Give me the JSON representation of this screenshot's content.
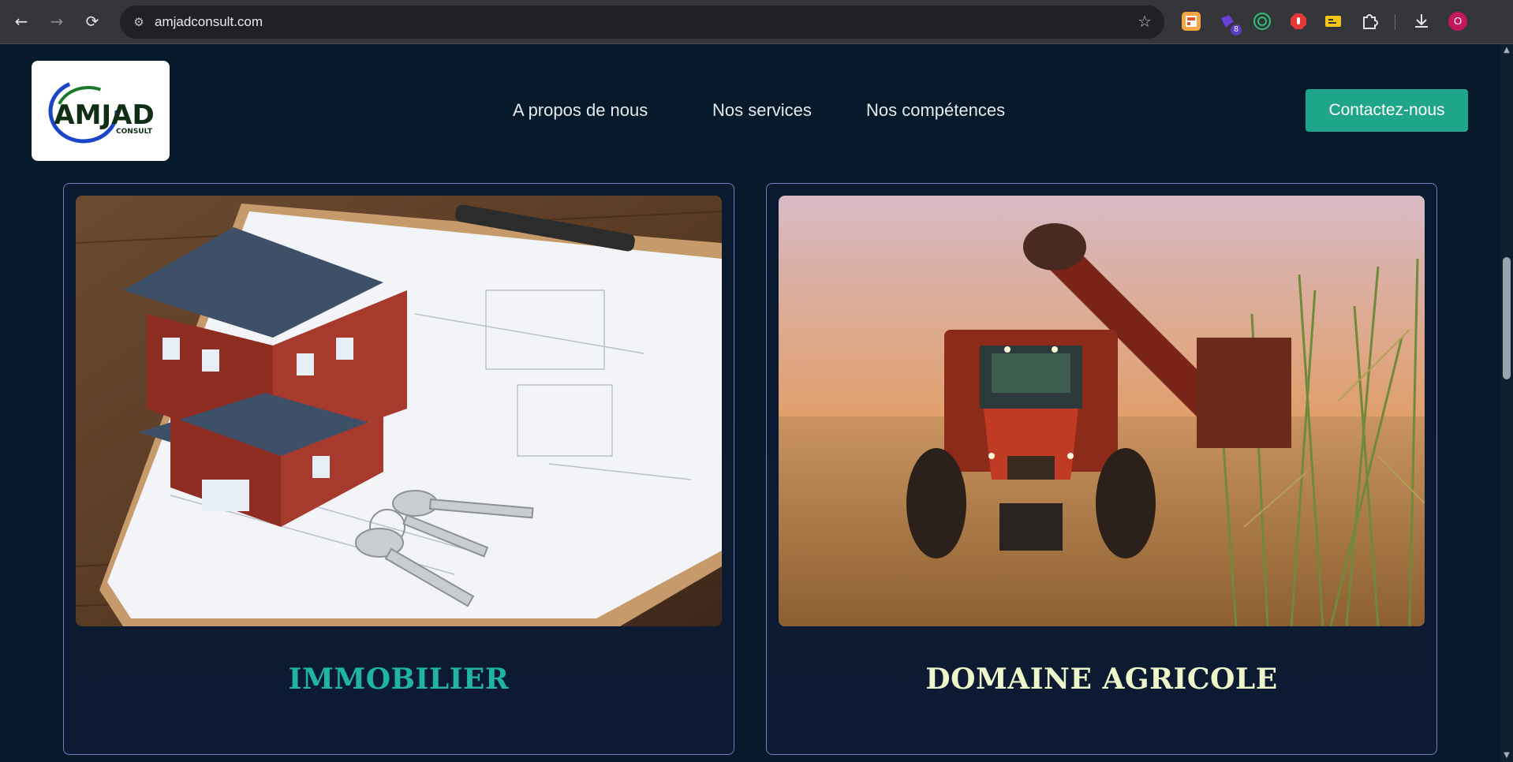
{
  "browser": {
    "url": "amjadconsult.com",
    "back_icon": "←",
    "forward_icon": "→",
    "reload_icon": "⟳",
    "site_info_icon": "⚙",
    "bookmark_icon": "☆",
    "extension_badge": "8",
    "download_icon": "⤓",
    "profile_initial": "O"
  },
  "header": {
    "logo_text": "AMJAD",
    "logo_subtext": "CONSULT",
    "nav": [
      "A propos de nous",
      "Nos services",
      "Nos compétences"
    ],
    "cta_label": "Contactez-nous"
  },
  "cards": [
    {
      "title": "IMMOBILIER",
      "title_color": "#1fb5a0"
    },
    {
      "title": "DOMAINE AGRICOLE",
      "title_color": "#eef7c9"
    }
  ],
  "colors": {
    "background": "#061a2b",
    "accent": "#1ea58a",
    "card_border": "#7d78b8"
  }
}
